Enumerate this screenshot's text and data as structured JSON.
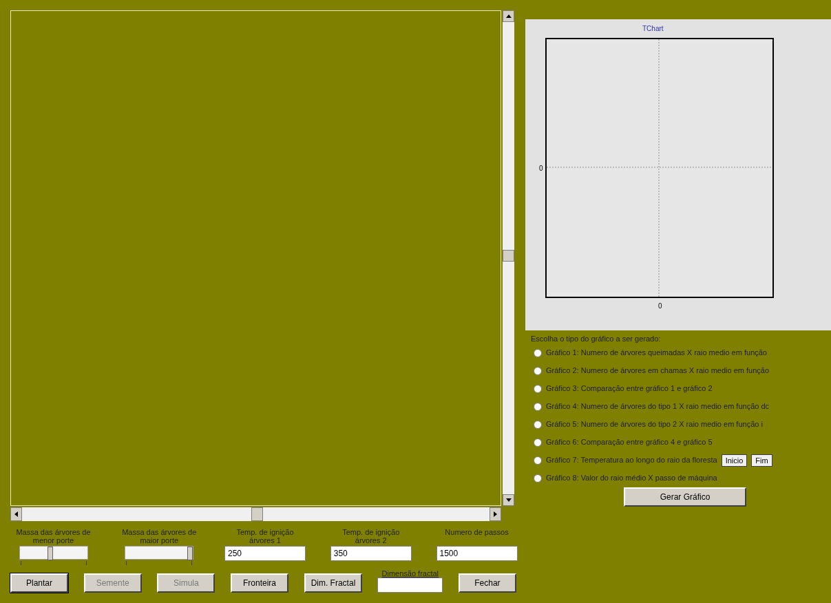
{
  "controls": [
    {
      "kind": "slider",
      "label": "Massa das árvores de menor porte",
      "level": 0.45
    },
    {
      "kind": "slider",
      "label": "Massa das árvores de maior porte",
      "level": 1
    },
    {
      "kind": "field",
      "label": "Temp. de ignição árvores 1",
      "value": "250"
    },
    {
      "kind": "field",
      "label": "Temp. de ignição árvores 2",
      "value": "350"
    },
    {
      "kind": "field",
      "label": "Numero de passos",
      "value": "1500"
    }
  ],
  "buttons": [
    {
      "kind": "button",
      "label": "Plantar",
      "disabled": false,
      "focused": true
    },
    {
      "kind": "button",
      "label": "Semente",
      "disabled": true,
      "focused": false
    },
    {
      "kind": "button",
      "label": "Simula",
      "disabled": true,
      "focused": false
    },
    {
      "kind": "button",
      "label": "Fronteira",
      "disabled": false,
      "focused": false
    },
    {
      "kind": "button",
      "label": "Dim. Fractal",
      "disabled": false,
      "focused": false
    },
    {
      "kind": "field",
      "label": "Dimensão fractal"
    },
    {
      "kind": "button",
      "label": "Fechar",
      "disabled": false,
      "focused": false
    }
  ],
  "chart": {
    "title": "TChart",
    "y_axis_label": "0",
    "x_axis_label": "0"
  },
  "chart_type": {
    "prompt": "Escolha o tipo do gráfico a ser gerado:",
    "options": [
      {
        "label": "Gráfico 1: Numero de árvores queimadas X raio medio em função",
        "selected": false
      },
      {
        "label": "Gráfico 2: Numero de árvores em chamas X raio medio em função",
        "selected": false
      },
      {
        "label": "Gráfico 3: Comparação entre gráfico 1 e gráfico 2",
        "selected": false
      },
      {
        "label": "Gráfico 4: Numero de árvores do tipo 1 X raio medio em função dc",
        "selected": false
      },
      {
        "label": "Gráfico 5: Numero de árvores do tipo 2 X raio medio em função i",
        "selected": false
      },
      {
        "label": "Gráfico 6: Comparação entre gráfico 4 e gráfico 5",
        "selected": false
      },
      {
        "label": "Gráfico 7: Temperatura ao longo do raio da floresta",
        "selected": false,
        "buttons": [
          "Inicio",
          "Fim"
        ]
      },
      {
        "label": "Gráfico 8: Valor do raio médio X passo de máquina",
        "selected": false
      }
    ],
    "generate_button": "Gerar Gráfico"
  }
}
